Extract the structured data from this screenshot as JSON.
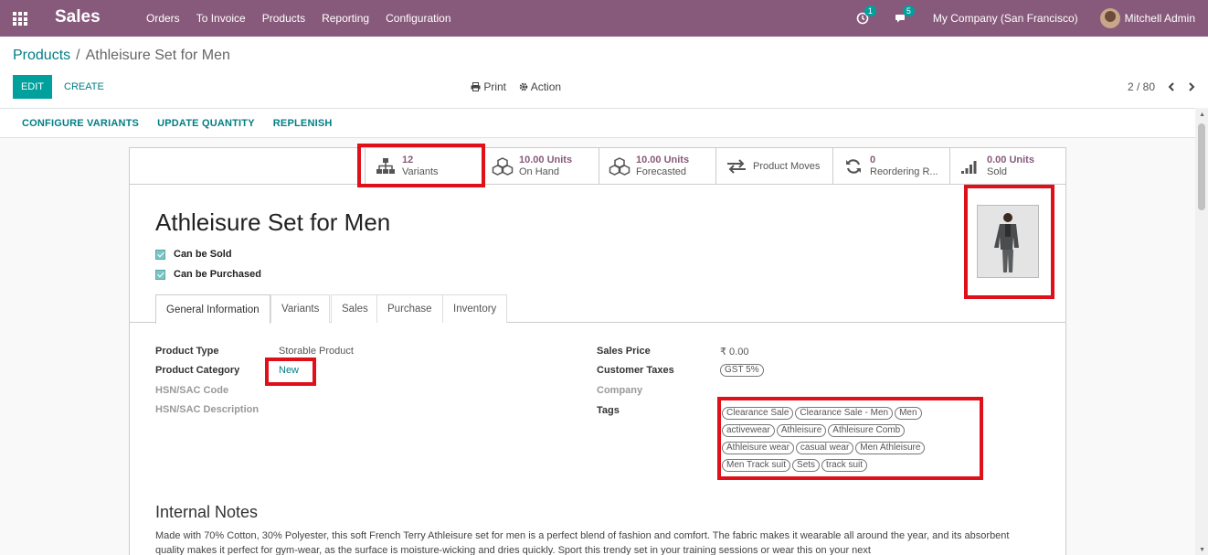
{
  "app": {
    "title": "Sales"
  },
  "menu": [
    "Orders",
    "To Invoice",
    "Products",
    "Reporting",
    "Configuration"
  ],
  "systray": {
    "activity_count": "1",
    "messages_count": "5",
    "company": "My Company (San Francisco)",
    "user": "Mitchell Admin"
  },
  "breadcrumb": {
    "parent": "Products",
    "current": "Athleisure Set for Men"
  },
  "buttons": {
    "edit": "EDIT",
    "create": "CREATE",
    "print": "Print",
    "action": "Action"
  },
  "pager": {
    "value": "2 / 80"
  },
  "status_buttons": [
    "CONFIGURE VARIANTS",
    "UPDATE QUANTITY",
    "REPLENISH"
  ],
  "smart_buttons": [
    {
      "value": "12",
      "label": "Variants",
      "icon": "sitemap-icon"
    },
    {
      "value": "10.00 Units",
      "label": "On Hand",
      "icon": "cubes-icon"
    },
    {
      "value": "10.00 Units",
      "label": "Forecasted",
      "icon": "cubes-icon"
    },
    {
      "value": "",
      "label": "Product Moves",
      "icon": "exchange-icon"
    },
    {
      "value": "0",
      "label": "Reordering R...",
      "icon": "refresh-icon"
    },
    {
      "value": "0.00 Units",
      "label": "Sold",
      "icon": "signal-icon"
    }
  ],
  "product": {
    "name": "Athleisure Set for Men",
    "can_be_sold": "Can be Sold",
    "can_be_purchased": "Can be Purchased"
  },
  "tabs": [
    "General Information",
    "Variants",
    "Sales",
    "Purchase",
    "Inventory"
  ],
  "fields_left": [
    {
      "label": "Product Type",
      "value": "Storable Product"
    },
    {
      "label": "Product Category",
      "value": "New"
    },
    {
      "label": "HSN/SAC Code",
      "value": ""
    },
    {
      "label": "HSN/SAC Description",
      "value": ""
    }
  ],
  "fields_right": [
    {
      "label": "Sales Price",
      "value": "₹ 0.00"
    },
    {
      "label": "Customer Taxes",
      "value": "GST 5%"
    },
    {
      "label": "Company",
      "value": ""
    },
    {
      "label": "Tags",
      "value": ""
    }
  ],
  "tags": [
    "Clearance Sale",
    "Clearance Sale - Men",
    "Men",
    "activewear",
    "Athleisure",
    "Athleisure Comb",
    "Athleisure wear",
    "casual wear",
    "Men Athleisure",
    "Men Track suit",
    "Sets",
    "track suit"
  ],
  "notes": {
    "title": "Internal Notes",
    "text": "Made with 70% Cotton, 30% Polyester, this soft French Terry Athleisure set for men is a perfect blend of fashion and comfort. The fabric makes it wearable all around the year, and its absorbent quality makes it perfect for gym-wear, as the surface is moisture-wicking and dries quickly. Sport this trendy set in your training sessions or wear this on your next"
  },
  "colors": {
    "navbar": "#875a7b",
    "primary": "#00a09d",
    "link": "#017e84",
    "highlight": "#e0101a"
  }
}
